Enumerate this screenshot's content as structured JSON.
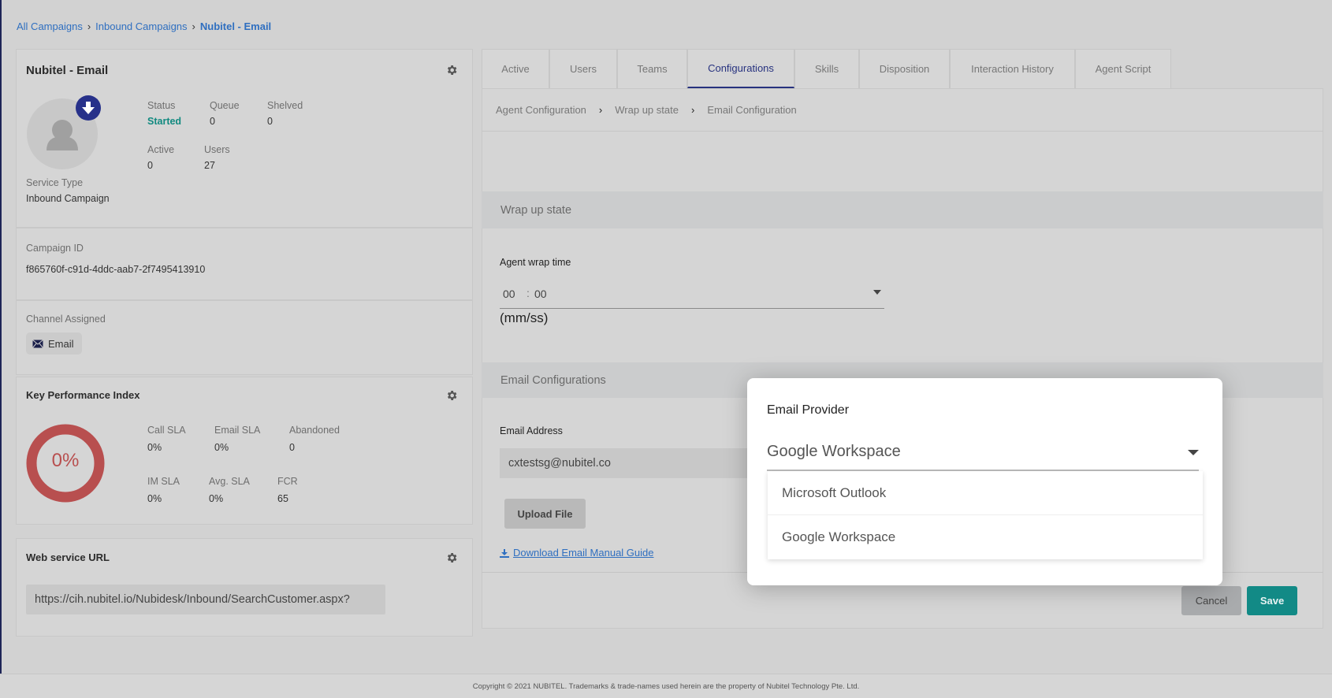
{
  "breadcrumb": {
    "items": [
      "All Campaigns",
      "Inbound Campaigns",
      "Nubitel - Email"
    ],
    "separator": "›"
  },
  "campaign": {
    "title": "Nubitel - Email",
    "stats": {
      "status_label": "Status",
      "status_value": "Started",
      "queue_label": "Queue",
      "queue_value": "0",
      "shelved_label": "Shelved",
      "shelved_value": "0",
      "active_label": "Active",
      "active_value": "0",
      "users_label": "Users",
      "users_value": "27"
    },
    "service_type_label": "Service Type",
    "service_type_value": "Inbound Campaign",
    "campaign_id_label": "Campaign ID",
    "campaign_id_value": "f865760f-c91d-4ddc-aab7-2f7495413910",
    "channel_label": "Channel Assigned",
    "channel_value": "Email"
  },
  "kpi": {
    "title": "Key Performance Index",
    "overall": "0%",
    "metrics": [
      {
        "label": "Call SLA",
        "value": "0%"
      },
      {
        "label": "Email SLA",
        "value": "0%"
      },
      {
        "label": "Abandoned",
        "value": "0"
      },
      {
        "label": "IM SLA",
        "value": "0%"
      },
      {
        "label": "Avg. SLA",
        "value": "0%"
      },
      {
        "label": "FCR",
        "value": "65"
      }
    ]
  },
  "webservice": {
    "title": "Web service URL",
    "url": "https://cih.nubitel.io/Nubidesk/Inbound/SearchCustomer.aspx?"
  },
  "tabs": [
    {
      "label": "Active"
    },
    {
      "label": "Users"
    },
    {
      "label": "Teams"
    },
    {
      "label": "Configurations",
      "active": true
    },
    {
      "label": "Skills"
    },
    {
      "label": "Disposition"
    },
    {
      "label": "Interaction History"
    },
    {
      "label": "Agent Script"
    }
  ],
  "subnav": [
    "Agent Configuration",
    "Wrap up state",
    "Email Configuration"
  ],
  "wrapup": {
    "header": "Wrap up state",
    "field_label": "Agent wrap time",
    "minutes": "00",
    "seconds": "00",
    "hint": "(mm/ss)"
  },
  "email_config": {
    "header": "Email Configurations",
    "address_label": "Email Address",
    "address_value": "cxtestsg@nubitel.co",
    "upload_label": "Upload File",
    "download_link": "Download Email Manual Guide"
  },
  "actions": {
    "cancel": "Cancel",
    "save": "Save"
  },
  "modal": {
    "label": "Email Provider",
    "selected": "Google Workspace",
    "options": [
      "Microsoft Outlook",
      "Google Workspace"
    ]
  },
  "footer": "Copyright © 2021 NUBITEL. Trademarks & trade-names used herein are the property of Nubitel Technology Pte. Ltd.",
  "colors": {
    "accent": "#27327f",
    "status_started": "#128a80",
    "save": "#128a86",
    "link": "#2f6fc0",
    "kpi_ring": "#b84f4f"
  }
}
